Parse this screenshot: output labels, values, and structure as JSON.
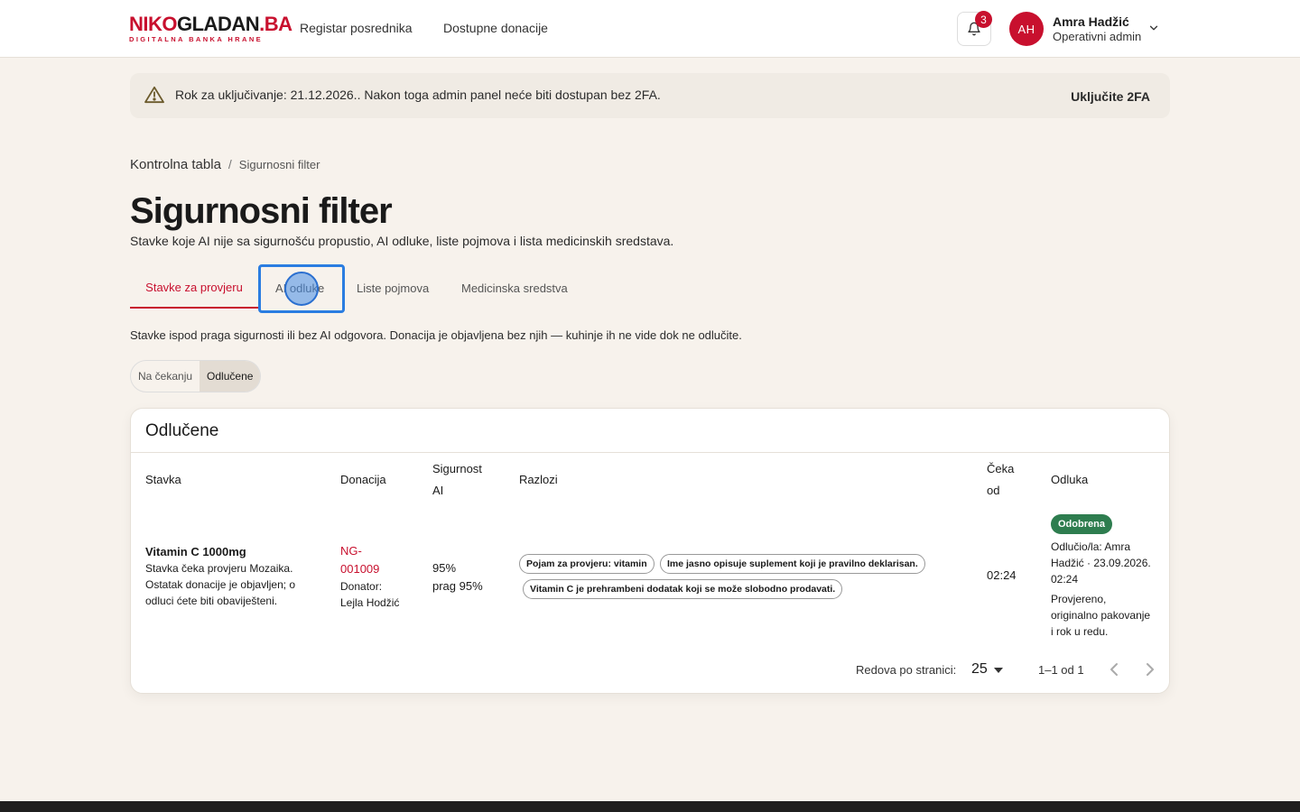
{
  "header": {
    "logo_part1": "NIKO",
    "logo_part2": "GLADAN",
    "logo_part3": ".BA",
    "logo_tagline": "DIGITALNA BANKA HRANE",
    "nav": [
      "Registar posrednika",
      "Dostupne donacije"
    ],
    "notification_count": "3",
    "user_initials": "AH",
    "user_name": "Amra Hadžić",
    "user_role": "Operativni admin"
  },
  "banner": {
    "text": "Rok za uključivanje: 21.12.2026.. Nakon toga admin panel neće biti dostupan bez 2FA.",
    "action": "Uključite 2FA"
  },
  "breadcrumb": {
    "parent": "Kontrolna tabla",
    "separator": "/",
    "current": "Sigurnosni filter"
  },
  "page": {
    "title": "Sigurnosni filter",
    "subtitle": "Stavke koje AI nije sa sigurnošću propustio, AI odluke, liste pojmova i lista medicinskih sredstava."
  },
  "tabs": [
    "Stavke za provjeru",
    "AI odluke",
    "Liste pojmova",
    "Medicinska sredstva"
  ],
  "tab_description": "Stavke ispod praga sigurnosti ili bez AI odgovora. Donacija je objavljena bez njih — kuhinje ih ne vide dok ne odlučite.",
  "filter": [
    "Na čekanju",
    "Odlučene"
  ],
  "card": {
    "title": "Odlučene",
    "columns": {
      "item": "Stavka",
      "donation": "Donacija",
      "confidence_l1": "Sigurnost",
      "confidence_l2": "AI",
      "reasons": "Razlozi",
      "waiting_l1": "Čeka",
      "waiting_l2": "od",
      "decision": "Odluka"
    },
    "row": {
      "item_name": "Vitamin C 1000mg",
      "item_note_l1": "Stavka čeka provjeru Mozaika.",
      "item_note_l2": "Ostatak donacije je objavljen; o",
      "item_note_l3": "odluci ćete biti obaviješteni.",
      "donation_l1": "NG-",
      "donation_l2": "001009",
      "donor_l1": "Donator:",
      "donor_l2": "Lejla Hodžić",
      "confidence": "95%",
      "threshold": "prag 95%",
      "reasons": [
        "Pojam za provjeru: vitamin",
        "Ime jasno opisuje suplement koji je pravilno deklarisan.",
        "Vitamin C je prehrambeni dodatak koji se može slobodno prodavati."
      ],
      "waiting": "02:24",
      "decision_status": "Odobrena",
      "decision_by_l1": "Odlučio/la: Amra",
      "decision_by_l2": "Hadžić · 23.09.2026.",
      "decision_by_l3": "02:24",
      "decision_note_l1": "Provjereno,",
      "decision_note_l2": "originalno pakovanje",
      "decision_note_l3": "i rok u redu."
    },
    "pager": {
      "rows_label": "Redova po stranici:",
      "rows_value": "25",
      "range": "1–1 od 1"
    }
  }
}
